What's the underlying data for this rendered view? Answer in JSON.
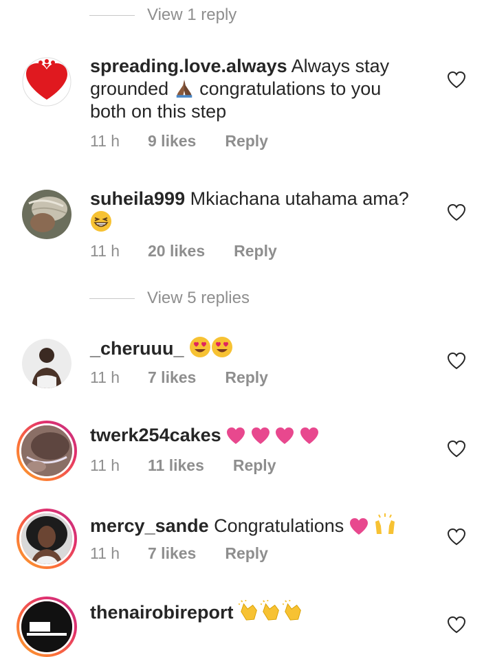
{
  "threads": [
    {
      "type": "view_replies",
      "label": "View 1 reply"
    },
    {
      "type": "comment",
      "username": "spreading.love.always",
      "text_a": "Always stay grounded",
      "text_b": "congratulations to you both on this step",
      "time": "11 h",
      "likes": "9 likes",
      "reply": "Reply"
    },
    {
      "type": "comment",
      "username": "suheila999",
      "text_a": "Mkiachana utahama ama?",
      "time": "11 h",
      "likes": "20 likes",
      "reply": "Reply"
    },
    {
      "type": "view_replies",
      "label": "View 5 replies"
    },
    {
      "type": "comment",
      "username": "_cheruuu_",
      "time": "11 h",
      "likes": "7 likes",
      "reply": "Reply"
    },
    {
      "type": "comment",
      "username": "twerk254cakes",
      "time": "11 h",
      "likes": "11 likes",
      "reply": "Reply"
    },
    {
      "type": "comment",
      "username": "mercy_sande",
      "text_a": "Congratulations",
      "time": "11 h",
      "likes": "7 likes",
      "reply": "Reply"
    },
    {
      "type": "comment",
      "username": "thenairobireport"
    }
  ],
  "icons": {
    "like": "heart-outline-icon",
    "folded_hands": "folded-hands-emoji",
    "grin": "grinning-squinting-face-emoji",
    "heart_eyes": "smiling-face-with-heart-eyes-emoji",
    "pink_heart": "heart-emoji",
    "raised_hands": "raising-hands-emoji",
    "clap": "clapping-hands-emoji"
  },
  "colors": {
    "text": "#262626",
    "secondary": "#8e8e8e",
    "heart_pink": "#e8488e",
    "story_ring": "#e1306c"
  }
}
